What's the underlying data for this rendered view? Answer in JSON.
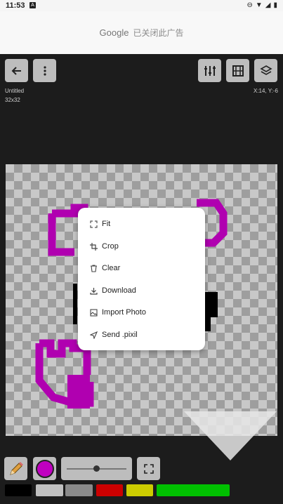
{
  "status": {
    "time": "11:53",
    "notif_icon": "A",
    "right_icons": [
      "dnd-icon",
      "wifi-icon",
      "signal-icon",
      "battery-icon"
    ]
  },
  "ad": {
    "brand": "Google",
    "text": "已关闭此广告"
  },
  "toolbar": {
    "back_icon": "back-arrow-icon",
    "more_icon": "more-vert-icon",
    "adjust_icon": "tune-icon",
    "frames_icon": "film-icon",
    "layers_icon": "layers-icon"
  },
  "doc": {
    "name": "Untitled",
    "size": "32x32",
    "coords": "X:14, Y:-6"
  },
  "menu": {
    "items": [
      {
        "label": "Fit",
        "icon": "fit-icon"
      },
      {
        "label": "Crop",
        "icon": "crop-icon"
      },
      {
        "label": "Clear",
        "icon": "trash-icon"
      },
      {
        "label": "Download",
        "icon": "download-icon"
      },
      {
        "label": "Import Photo",
        "icon": "image-icon"
      },
      {
        "label": "Send .pixil",
        "icon": "send-icon"
      }
    ]
  },
  "bottom": {
    "pencil_icon": "pencil-icon",
    "current_color": "#c000c0",
    "fullscreen_icon": "fullscreen-icon"
  },
  "brush_size": {
    "min": 0,
    "max": 1,
    "value": 0.5
  },
  "palette": [
    "#000000",
    "#c0c0c0",
    "#8a8a8a",
    "#cc0000",
    "#cccc00",
    "#00c000"
  ]
}
